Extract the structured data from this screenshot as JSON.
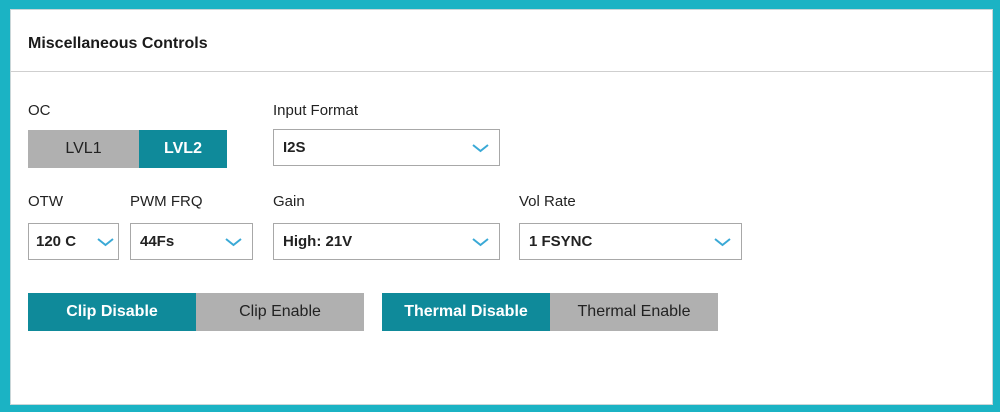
{
  "panel": {
    "title": "Miscellaneous Controls"
  },
  "oc": {
    "label": "OC",
    "options": [
      "LVL1",
      "LVL2"
    ],
    "selected": "LVL2"
  },
  "input_format": {
    "label": "Input Format",
    "value": "I2S"
  },
  "otw": {
    "label": "OTW",
    "value": "120 C"
  },
  "pwm_frq": {
    "label": "PWM FRQ",
    "value": "44Fs"
  },
  "gain": {
    "label": "Gain",
    "value": "High: 21V"
  },
  "vol_rate": {
    "label": "Vol Rate",
    "value": "1 FSYNC"
  },
  "clip": {
    "options": [
      "Clip Disable",
      "Clip Enable"
    ],
    "selected": "Clip Disable"
  },
  "thermal": {
    "options": [
      "Thermal Disable",
      "Thermal Enable"
    ],
    "selected": "Thermal Disable"
  },
  "colors": {
    "accent": "#0f8a9a",
    "inactive": "#b0b0b0",
    "frame": "#1bb3c4"
  }
}
